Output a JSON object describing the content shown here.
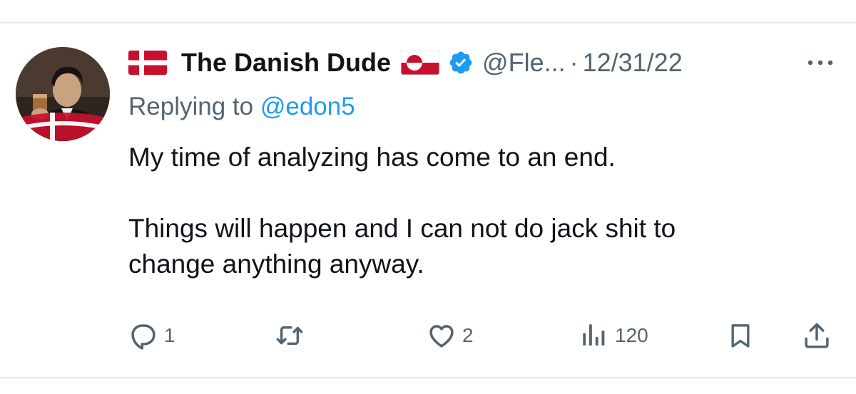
{
  "tweet": {
    "author": {
      "display_name": "The Danish Dude",
      "handle": "@Fle...",
      "verified": true,
      "avatar": "avatar-photo",
      "name_prefix_icon": "denmark-flag-icon",
      "name_suffix_icon": "greenland-flag-icon"
    },
    "separator": "·",
    "date": "12/31/22",
    "more_icon": "more-options-icon",
    "replying_to": {
      "prefix": "Replying to",
      "mention": "@edon5"
    },
    "text": {
      "paragraph_1": "My time of analyzing has come to an end.",
      "paragraph_2_line_1": "Things will happen and I can not do jack shit to",
      "paragraph_2_line_2": "change anything anyway."
    },
    "actions": {
      "reply": {
        "icon": "reply-icon",
        "count": "1"
      },
      "retweet": {
        "icon": "retweet-icon"
      },
      "like": {
        "icon": "heart-icon",
        "count": "2"
      },
      "views": {
        "icon": "views-icon",
        "count": "120"
      },
      "bookmark": {
        "icon": "bookmark-icon"
      },
      "share": {
        "icon": "share-icon"
      }
    }
  },
  "colors": {
    "text_primary": "#0f1419",
    "text_secondary": "#536471",
    "accent_blue": "#1d9bf0",
    "divider": "#e6e9ec",
    "danish_red": "#c8102e"
  }
}
